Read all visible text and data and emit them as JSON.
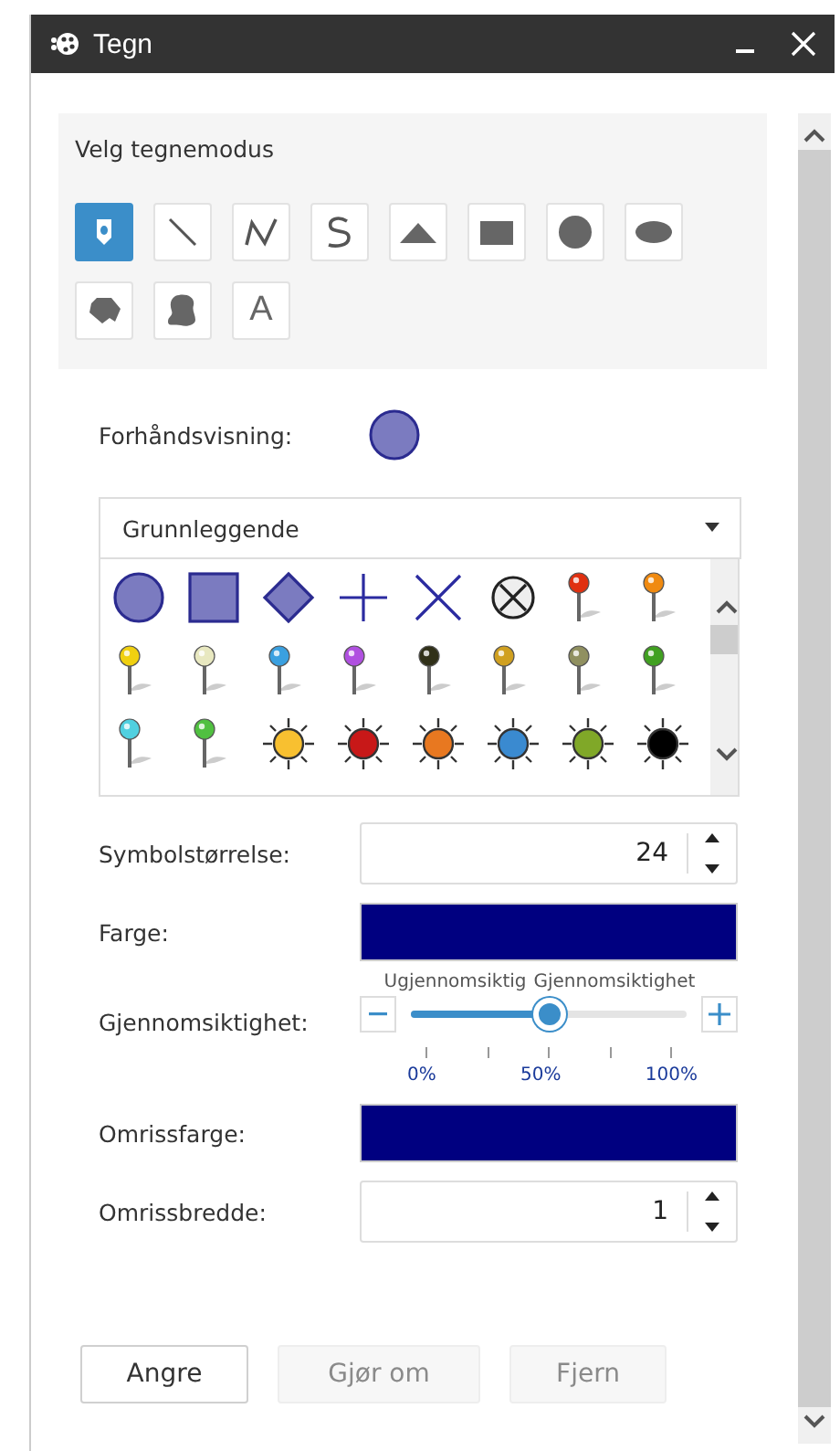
{
  "window": {
    "title": "Tegn"
  },
  "mode_section": {
    "title": "Velg tegnemodus",
    "tools": [
      {
        "kind": "point",
        "selected": true
      },
      {
        "kind": "line",
        "selected": false
      },
      {
        "kind": "polyline",
        "selected": false
      },
      {
        "kind": "freehand-line",
        "selected": false
      },
      {
        "kind": "triangle",
        "selected": false
      },
      {
        "kind": "rectangle",
        "selected": false
      },
      {
        "kind": "circle",
        "selected": false
      },
      {
        "kind": "ellipse",
        "selected": false
      },
      {
        "kind": "polygon",
        "selected": false
      },
      {
        "kind": "freehand-polygon",
        "selected": false
      },
      {
        "kind": "text",
        "selected": false,
        "label": "A"
      }
    ]
  },
  "preview": {
    "label": "Forhåndsvisning:"
  },
  "symbol_set": {
    "value": "Grunnleggende"
  },
  "symbols": [
    {
      "kind": "circle",
      "color": "#7b7bc0"
    },
    {
      "kind": "square",
      "color": "#7b7bc0"
    },
    {
      "kind": "diamond",
      "color": "#7b7bc0"
    },
    {
      "kind": "cross",
      "color": "#2b2ba0"
    },
    {
      "kind": "x",
      "color": "#2b2ba0"
    },
    {
      "kind": "circled-x",
      "color": "#222222"
    },
    {
      "kind": "pin",
      "color": "#e03010"
    },
    {
      "kind": "pin",
      "color": "#f08a10"
    },
    {
      "kind": "pin",
      "color": "#f0d010"
    },
    {
      "kind": "pin",
      "color": "#e8e8c0"
    },
    {
      "kind": "pin",
      "color": "#3aa0e0"
    },
    {
      "kind": "pin",
      "color": "#b050e0"
    },
    {
      "kind": "pin",
      "color": "#303018"
    },
    {
      "kind": "pin",
      "color": "#d0a020"
    },
    {
      "kind": "pin",
      "color": "#909060"
    },
    {
      "kind": "pin",
      "color": "#40a020"
    },
    {
      "kind": "pin",
      "color": "#50d0e0"
    },
    {
      "kind": "pin",
      "color": "#50c040"
    },
    {
      "kind": "sun",
      "color": "#f8c030"
    },
    {
      "kind": "sun",
      "color": "#c81818"
    },
    {
      "kind": "sun",
      "color": "#e87820"
    },
    {
      "kind": "sun",
      "color": "#3a8ad0"
    },
    {
      "kind": "sun",
      "color": "#80a828"
    },
    {
      "kind": "sun",
      "color": "#000000"
    }
  ],
  "fields": [
    {
      "kind": "number",
      "label": "Symbolstørrelse:",
      "value": "24"
    },
    {
      "kind": "color",
      "label": "Farge:",
      "color": "#000080"
    },
    {
      "kind": "slider",
      "label": "Gjennomsiktighet:",
      "left_caption": "Ugjennomsiktig",
      "right_caption": "Gjennomsiktighet",
      "level": 0.5,
      "ticks": [
        "0%",
        "50%",
        "100%"
      ]
    },
    {
      "kind": "color",
      "label": "Omrissfarge:",
      "color": "#000080"
    },
    {
      "kind": "number",
      "label": "Omrissbredde:",
      "value": "1"
    }
  ],
  "buttons": [
    {
      "label": "Angre",
      "disabled": false
    },
    {
      "label": "Gjør om",
      "disabled": true
    },
    {
      "label": "Fjern",
      "disabled": true
    }
  ]
}
